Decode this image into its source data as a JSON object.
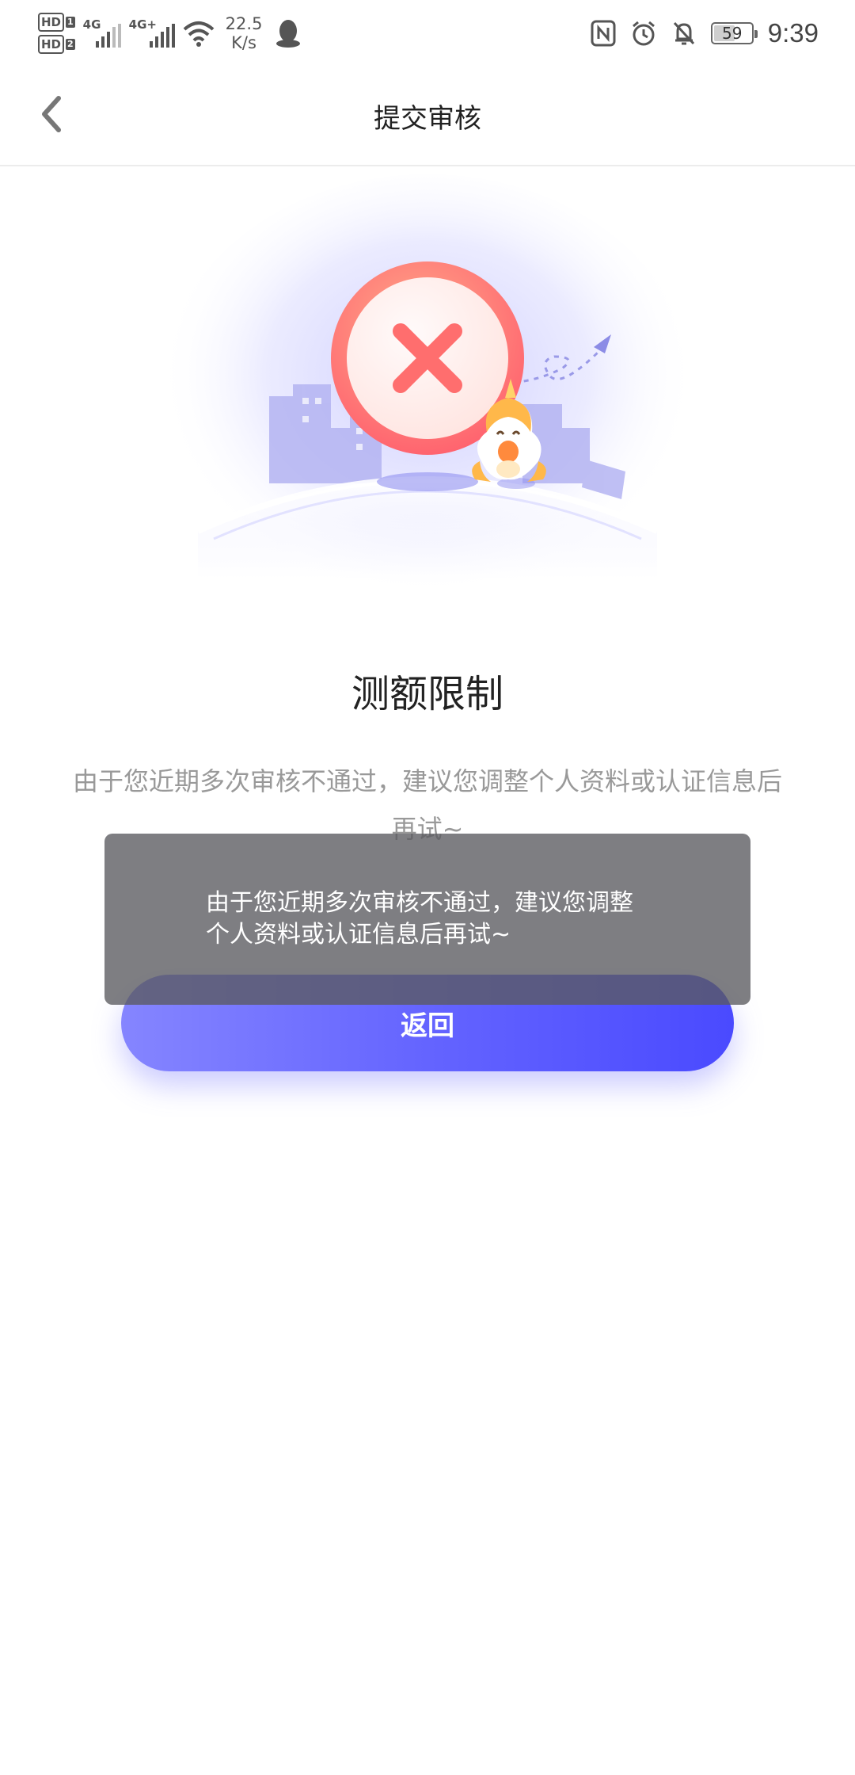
{
  "status_bar": {
    "sim1": "HD",
    "sim1_slot": "1",
    "sim2": "HD",
    "sim2_slot": "2",
    "net1": "4G",
    "net2": "4G+",
    "speed_value": "22.5",
    "speed_unit": "K/s",
    "battery": "59",
    "time": "9:39",
    "icons": [
      "hd-icon",
      "signal-icon",
      "wifi-icon",
      "qq-icon",
      "nfc-icon",
      "alarm-icon",
      "mute-bell-icon",
      "battery-icon"
    ]
  },
  "nav": {
    "title": "提交审核",
    "back_icon": "chevron-left-icon"
  },
  "result": {
    "title": "测额限制",
    "description": "由于您近期多次审核不通过，建议您调整个人资料或认证信息后再试~",
    "illustration": "error-x-circle-with-mascot"
  },
  "button": {
    "label": "返回"
  },
  "toast": {
    "message": "由于您近期多次审核不通过，建议您调整个人资料或认证信息后再试~"
  },
  "colors": {
    "accent_start": "#8585ff",
    "accent_end": "#4a4aff",
    "error_red": "#ff6e6e"
  }
}
